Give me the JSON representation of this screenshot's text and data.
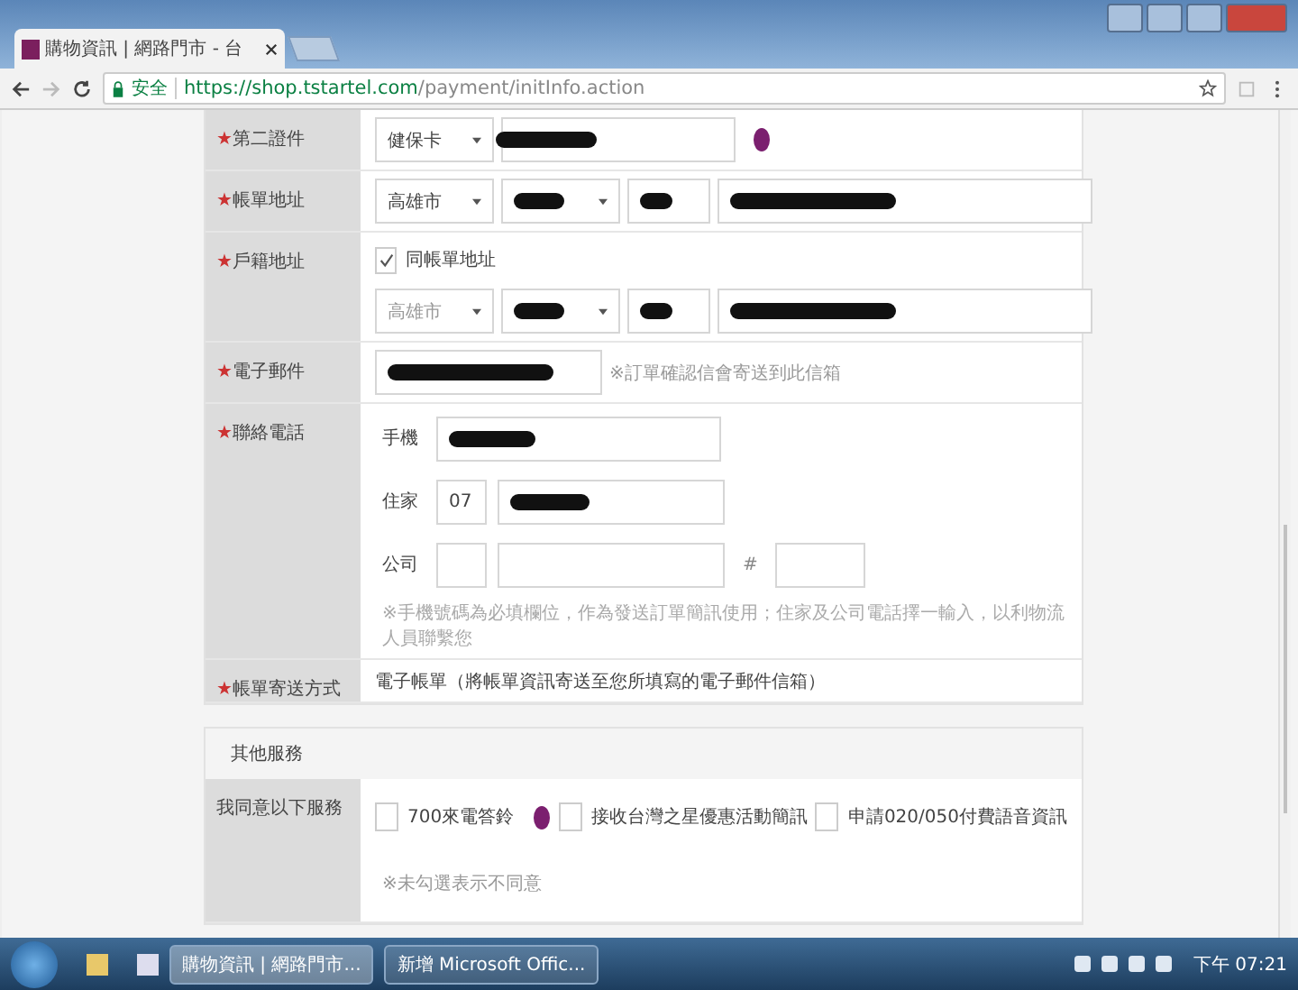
{
  "browser": {
    "tab": {
      "title": "購物資訊 | 網路門市 - 台"
    },
    "address_bar": {
      "secure_label": "安全",
      "url_host": "https://shop.tstartel.com",
      "url_path": "/payment/initInfo.action"
    }
  },
  "form": {
    "rows": [
      {
        "kind": "id",
        "marker": "★",
        "label": "第二證件",
        "select": "健保卡",
        "info": true
      },
      {
        "kind": "address",
        "marker": "★",
        "label": "帳單地址",
        "select": "高雄市"
      },
      {
        "kind": "address_same",
        "marker": "★",
        "label": "戶籍地址",
        "checkbox": {
          "label": "同帳單地址",
          "checked": true
        },
        "select": "高雄市"
      },
      {
        "kind": "email",
        "marker": "★",
        "label": "電子郵件",
        "note": "※訂單確認信會寄送到此信箱"
      },
      {
        "kind": "phone",
        "marker": "★",
        "label": "聯絡電話",
        "lines": [
          {
            "label": "手機"
          },
          {
            "label": "住家",
            "area": "07"
          },
          {
            "label": "公司",
            "ext_sep": "#"
          }
        ],
        "note": "※手機號碼為必填欄位，作為發送訂單簡訊使用；住家及公司電話擇一輸入，以利物流人員聯繫您"
      },
      {
        "kind": "text",
        "marker": "★",
        "label": "帳單寄送方式",
        "value": "電子帳單（將帳單資訊寄送至您所填寫的電子郵件信箱）"
      }
    ]
  },
  "other_services": {
    "title": "其他服務",
    "label": "我同意以下服務",
    "options": [
      {
        "label": "700來電答鈴",
        "checked": false,
        "info": true
      },
      {
        "label": "接收台灣之星優惠活動簡訊",
        "checked": false,
        "info": false
      },
      {
        "label": "申請020/050付費語音資訊",
        "checked": false,
        "info": false
      }
    ],
    "note": "※未勾選表示不同意"
  },
  "taskbar": {
    "items": [
      {
        "label": "購物資訊 | 網路門市...",
        "selected": true
      },
      {
        "label": "新增 Microsoft Offic...",
        "selected": false
      }
    ],
    "clock": "下午 07:21"
  }
}
